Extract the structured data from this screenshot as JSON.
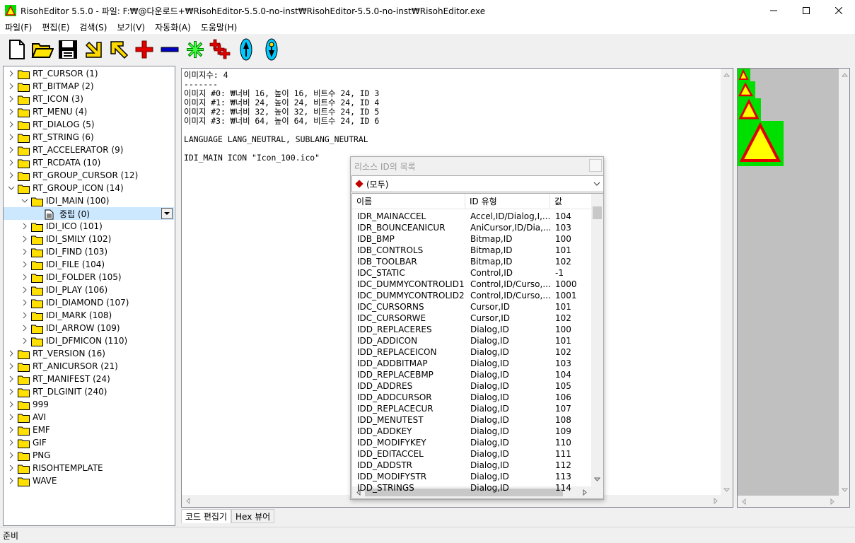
{
  "window": {
    "title": "RisohEditor 5.5.0 - 파일: F:₩@다운로드+₩RisohEditor-5.5.0-no-inst₩RisohEditor-5.5.0-no-inst₩RisohEditor.exe"
  },
  "menu": [
    "파일(F)",
    "편집(E)",
    "검색(S)",
    "보기(V)",
    "자동화(A)",
    "도움말(H)"
  ],
  "toolbar": [
    "new-icon",
    "open-folder-icon",
    "save-icon",
    "arrow-down-left-icon",
    "arrow-up-left-icon",
    "add-icon",
    "remove-icon",
    "asterisk-icon",
    "add-multiple-icon",
    "move-up-icon",
    "move-down-icon"
  ],
  "tree": [
    {
      "label": "RT_CURSOR (1)",
      "level": 0,
      "exp": ">"
    },
    {
      "label": "RT_BITMAP (2)",
      "level": 0,
      "exp": ">"
    },
    {
      "label": "RT_ICON (3)",
      "level": 0,
      "exp": ">"
    },
    {
      "label": "RT_MENU (4)",
      "level": 0,
      "exp": ">"
    },
    {
      "label": "RT_DIALOG (5)",
      "level": 0,
      "exp": ">"
    },
    {
      "label": "RT_STRING (6)",
      "level": 0,
      "exp": ">"
    },
    {
      "label": "RT_ACCELERATOR (9)",
      "level": 0,
      "exp": ">"
    },
    {
      "label": "RT_RCDATA (10)",
      "level": 0,
      "exp": ">"
    },
    {
      "label": "RT_GROUP_CURSOR (12)",
      "level": 0,
      "exp": ">"
    },
    {
      "label": "RT_GROUP_ICON (14)",
      "level": 0,
      "exp": "v"
    },
    {
      "label": "IDI_MAIN (100)",
      "level": 1,
      "exp": "v"
    },
    {
      "label": "중립 (0)",
      "level": 2,
      "exp": "",
      "leaf": true
    },
    {
      "label": "IDI_ICO (101)",
      "level": 1,
      "exp": ">"
    },
    {
      "label": "IDI_SMILY (102)",
      "level": 1,
      "exp": ">"
    },
    {
      "label": "IDI_FIND (103)",
      "level": 1,
      "exp": ">"
    },
    {
      "label": "IDI_FILE (104)",
      "level": 1,
      "exp": ">"
    },
    {
      "label": "IDI_FOLDER (105)",
      "level": 1,
      "exp": ">"
    },
    {
      "label": "IDI_PLAY (106)",
      "level": 1,
      "exp": ">"
    },
    {
      "label": "IDI_DIAMOND (107)",
      "level": 1,
      "exp": ">"
    },
    {
      "label": "IDI_MARK (108)",
      "level": 1,
      "exp": ">"
    },
    {
      "label": "IDI_ARROW (109)",
      "level": 1,
      "exp": ">"
    },
    {
      "label": "IDI_DFMICON (110)",
      "level": 1,
      "exp": ">"
    },
    {
      "label": "RT_VERSION (16)",
      "level": 0,
      "exp": ">"
    },
    {
      "label": "RT_ANICURSOR (21)",
      "level": 0,
      "exp": ">"
    },
    {
      "label": "RT_MANIFEST (24)",
      "level": 0,
      "exp": ">"
    },
    {
      "label": "RT_DLGINIT (240)",
      "level": 0,
      "exp": ">"
    },
    {
      "label": "999",
      "level": 0,
      "exp": ">"
    },
    {
      "label": "AVI",
      "level": 0,
      "exp": ">"
    },
    {
      "label": "EMF",
      "level": 0,
      "exp": ">"
    },
    {
      "label": "GIF",
      "level": 0,
      "exp": ">"
    },
    {
      "label": "PNG",
      "level": 0,
      "exp": ">"
    },
    {
      "label": "RISOHTEMPLATE",
      "level": 0,
      "exp": ">"
    },
    {
      "label": "WAVE",
      "level": 0,
      "exp": ">"
    }
  ],
  "code": {
    "lines": [
      "이미지수: 4",
      "-------",
      "이미지 #0: ₩너비 16, 높이 16, 비트수 24, ID 3",
      "이미지 #1: ₩너비 24, 높이 24, 비트수 24, ID 4",
      "이미지 #2: ₩너비 32, 높이 32, 비트수 24, ID 5",
      "이미지 #3: ₩너비 64, 높이 64, 비트수 24, ID 6",
      "",
      "LANGUAGE LANG_NEUTRAL, SUBLANG_NEUTRAL",
      "",
      "IDI_MAIN ICON \"Icon_100.ico\""
    ]
  },
  "tabs": [
    "코드 편집기",
    "Hex 뷰어"
  ],
  "status": "준비",
  "dialog": {
    "title": "리소스 ID의 목록",
    "filter": "(모두)",
    "columns": [
      "이름",
      "ID 유형",
      "값"
    ],
    "rows": [
      [
        "IDR_MAINACCEL",
        "Accel,ID/Dialog,I,...",
        "104"
      ],
      [
        "IDR_BOUNCEANICUR",
        "AniCursor,ID/Dia,...",
        "103"
      ],
      [
        "IDB_BMP",
        "Bitmap,ID",
        "100"
      ],
      [
        "IDB_CONTROLS",
        "Bitmap,ID",
        "101"
      ],
      [
        "IDB_TOOLBAR",
        "Bitmap,ID",
        "102"
      ],
      [
        "IDC_STATIC",
        "Control,ID",
        "-1"
      ],
      [
        "IDC_DUMMYCONTROLID1",
        "Control,ID/Curso,...",
        "1000"
      ],
      [
        "IDC_DUMMYCONTROLID2",
        "Control,ID/Curso,...",
        "1001"
      ],
      [
        "IDC_CURSORNS",
        "Cursor,ID",
        "101"
      ],
      [
        "IDC_CURSORWE",
        "Cursor,ID",
        "102"
      ],
      [
        "IDD_REPLACERES",
        "Dialog,ID",
        "100"
      ],
      [
        "IDD_ADDICON",
        "Dialog,ID",
        "101"
      ],
      [
        "IDD_REPLACEICON",
        "Dialog,ID",
        "102"
      ],
      [
        "IDD_ADDBITMAP",
        "Dialog,ID",
        "103"
      ],
      [
        "IDD_REPLACEBMP",
        "Dialog,ID",
        "104"
      ],
      [
        "IDD_ADDRES",
        "Dialog,ID",
        "105"
      ],
      [
        "IDD_ADDCURSOR",
        "Dialog,ID",
        "106"
      ],
      [
        "IDD_REPLACECUR",
        "Dialog,ID",
        "107"
      ],
      [
        "IDD_MENUTEST",
        "Dialog,ID",
        "108"
      ],
      [
        "IDD_ADDKEY",
        "Dialog,ID",
        "109"
      ],
      [
        "IDD_MODIFYKEY",
        "Dialog,ID",
        "110"
      ],
      [
        "IDD_EDITACCEL",
        "Dialog,ID",
        "111"
      ],
      [
        "IDD_ADDSTR",
        "Dialog,ID",
        "112"
      ],
      [
        "IDD_MODIFYSTR",
        "Dialog,ID",
        "113"
      ],
      [
        "IDD_STRINGS",
        "Dialog,ID",
        "114"
      ]
    ]
  }
}
